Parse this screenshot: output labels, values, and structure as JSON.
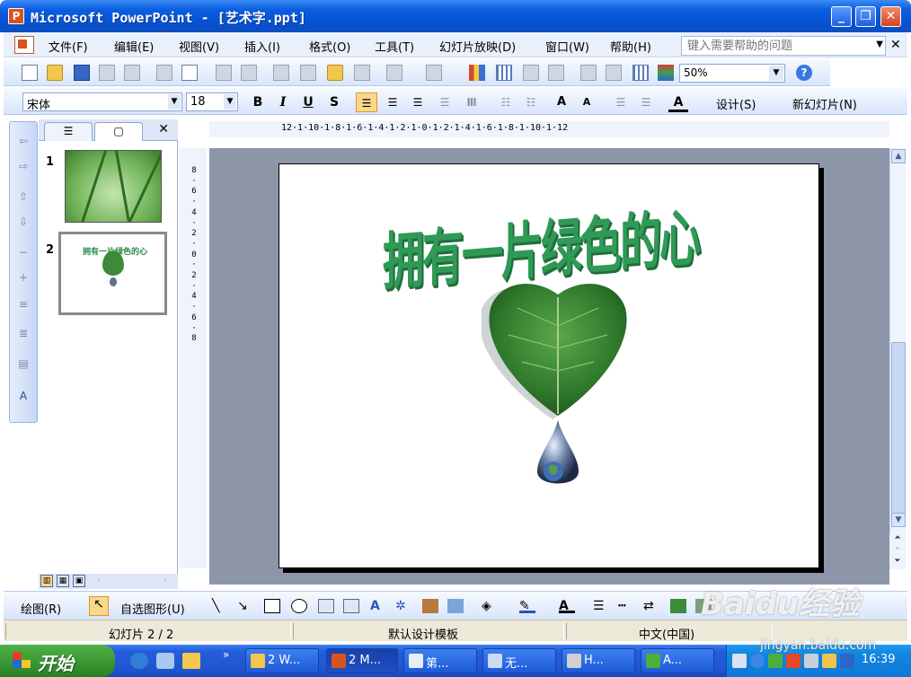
{
  "window": {
    "title": "Microsoft PowerPoint - [艺术字.ppt]",
    "app_icon": "P"
  },
  "menubar": {
    "items": [
      "文件(F)",
      "编辑(E)",
      "视图(V)",
      "插入(I)",
      "格式(O)",
      "工具(T)",
      "幻灯片放映(D)",
      "窗口(W)",
      "帮助(H)"
    ],
    "help_placeholder": "键入需要帮助的问题"
  },
  "standard_toolbar": {
    "zoom": "50%"
  },
  "format_toolbar": {
    "font": "宋体",
    "size": "18",
    "bold": "B",
    "italic": "I",
    "underline": "U",
    "shadow": "S",
    "design_label": "设计(S)",
    "new_slide_label": "新幻灯片(N)"
  },
  "slides_pane": {
    "slides": [
      {
        "number": "1"
      },
      {
        "number": "2",
        "selected": true,
        "thumb_text": "拥有一片绿色的心"
      }
    ]
  },
  "ruler": {
    "horizontal": "12·1·10·1·8·1·6·1·4·1·2·1·0·1·2·1·4·1·6·1·8·1·10·1·12",
    "vertical": "8·6·4·2·0·2·4·6·8"
  },
  "slide": {
    "wordart": "拥有一片绿色的心"
  },
  "drawing_toolbar": {
    "draw_label": "绘图(R)",
    "autoshapes_label": "自选图形(U)"
  },
  "statusbar": {
    "slide_position": "幻灯片 2 / 2",
    "template": "默认设计模板",
    "language": "中文(中国)"
  },
  "taskbar": {
    "start_label": "开始",
    "tasks": [
      "2 W...",
      "2 M...",
      "第...",
      "无...",
      "H...",
      "A..."
    ],
    "clock": "16:39"
  },
  "watermark": {
    "brand": "Baidu经验",
    "url": "jingyan.baidu.com"
  },
  "colors": {
    "title_bar": "#0653d2",
    "wordart_green": "#2f9a55",
    "workspace": "#8d95a8",
    "start_green": "#37962f"
  }
}
